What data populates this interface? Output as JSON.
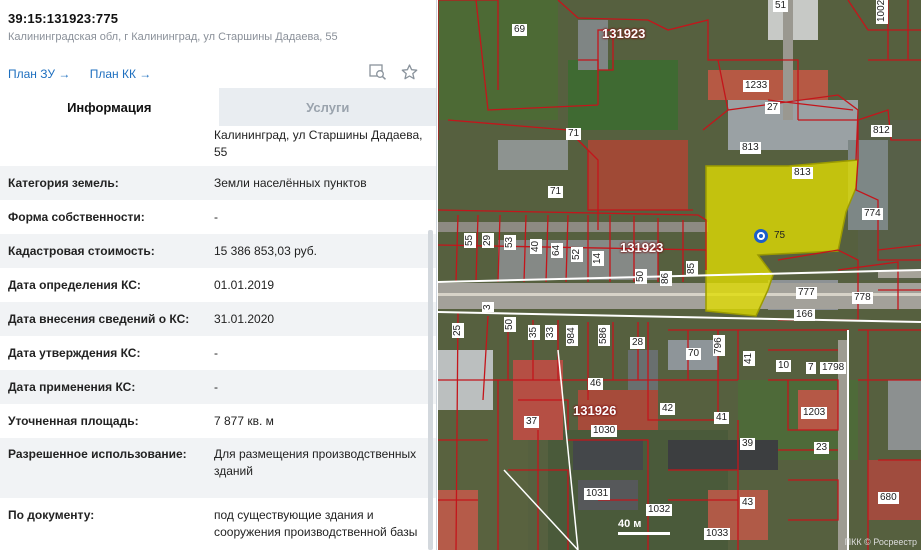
{
  "parcel": {
    "number": "39:15:131923:775",
    "address": "Калининградская обл, г Калининград, ул Старшины Дадаева, 55"
  },
  "links": {
    "plan_zu": "План ЗУ →",
    "plan_kk": "План КК →"
  },
  "tools": {
    "icons": [
      "search-map-icon",
      "star-icon"
    ]
  },
  "tabs": {
    "info": "Информация",
    "services": "Услуги"
  },
  "address_continuation": "Калининград, ул Старшины Дадаева, 55",
  "fields": [
    {
      "label": "Категория земель:",
      "value": "Земли населённых пунктов"
    },
    {
      "label": "Форма собственности:",
      "value": "-"
    },
    {
      "label": "Кадастровая стоимость:",
      "value": "15 386 853,03 руб."
    },
    {
      "label": "Дата определения КС:",
      "value": "01.01.2019"
    },
    {
      "label": "Дата внесения сведений о КС:",
      "value": "31.01.2020"
    },
    {
      "label": "Дата утверждения КС:",
      "value": "-"
    },
    {
      "label": "Дата применения КС:",
      "value": "-"
    },
    {
      "label": "Уточненная площадь:",
      "value": "7 877 кв. м"
    },
    {
      "label": "Разрешенное использование:",
      "value": "Для размещения производственных зданий"
    },
    {
      "label": "По документу:",
      "value": "под существующие здания и сооружения производственной базы"
    }
  ],
  "map": {
    "blocks": [
      "131923",
      "131923",
      "131926"
    ],
    "labels": [
      "69",
      "51",
      "1002",
      "1233",
      "27",
      "812",
      "71",
      "813",
      "813",
      "71",
      "774",
      "75",
      "55",
      "29",
      "53",
      "40",
      "64",
      "52",
      "14",
      "50",
      "86",
      "85",
      "777",
      "778",
      "166",
      "25",
      "3",
      "50",
      "35",
      "33",
      "984",
      "586",
      "28",
      "796",
      "70",
      "41",
      "10",
      "7",
      "1798",
      "46",
      "42",
      "41",
      "1203",
      "37",
      "1030",
      "39",
      "23",
      "680",
      "1031",
      "43",
      "1032",
      "1033"
    ],
    "marker_label": "75",
    "scale": "40 м",
    "attribution": "ПКК © Росреестр"
  }
}
